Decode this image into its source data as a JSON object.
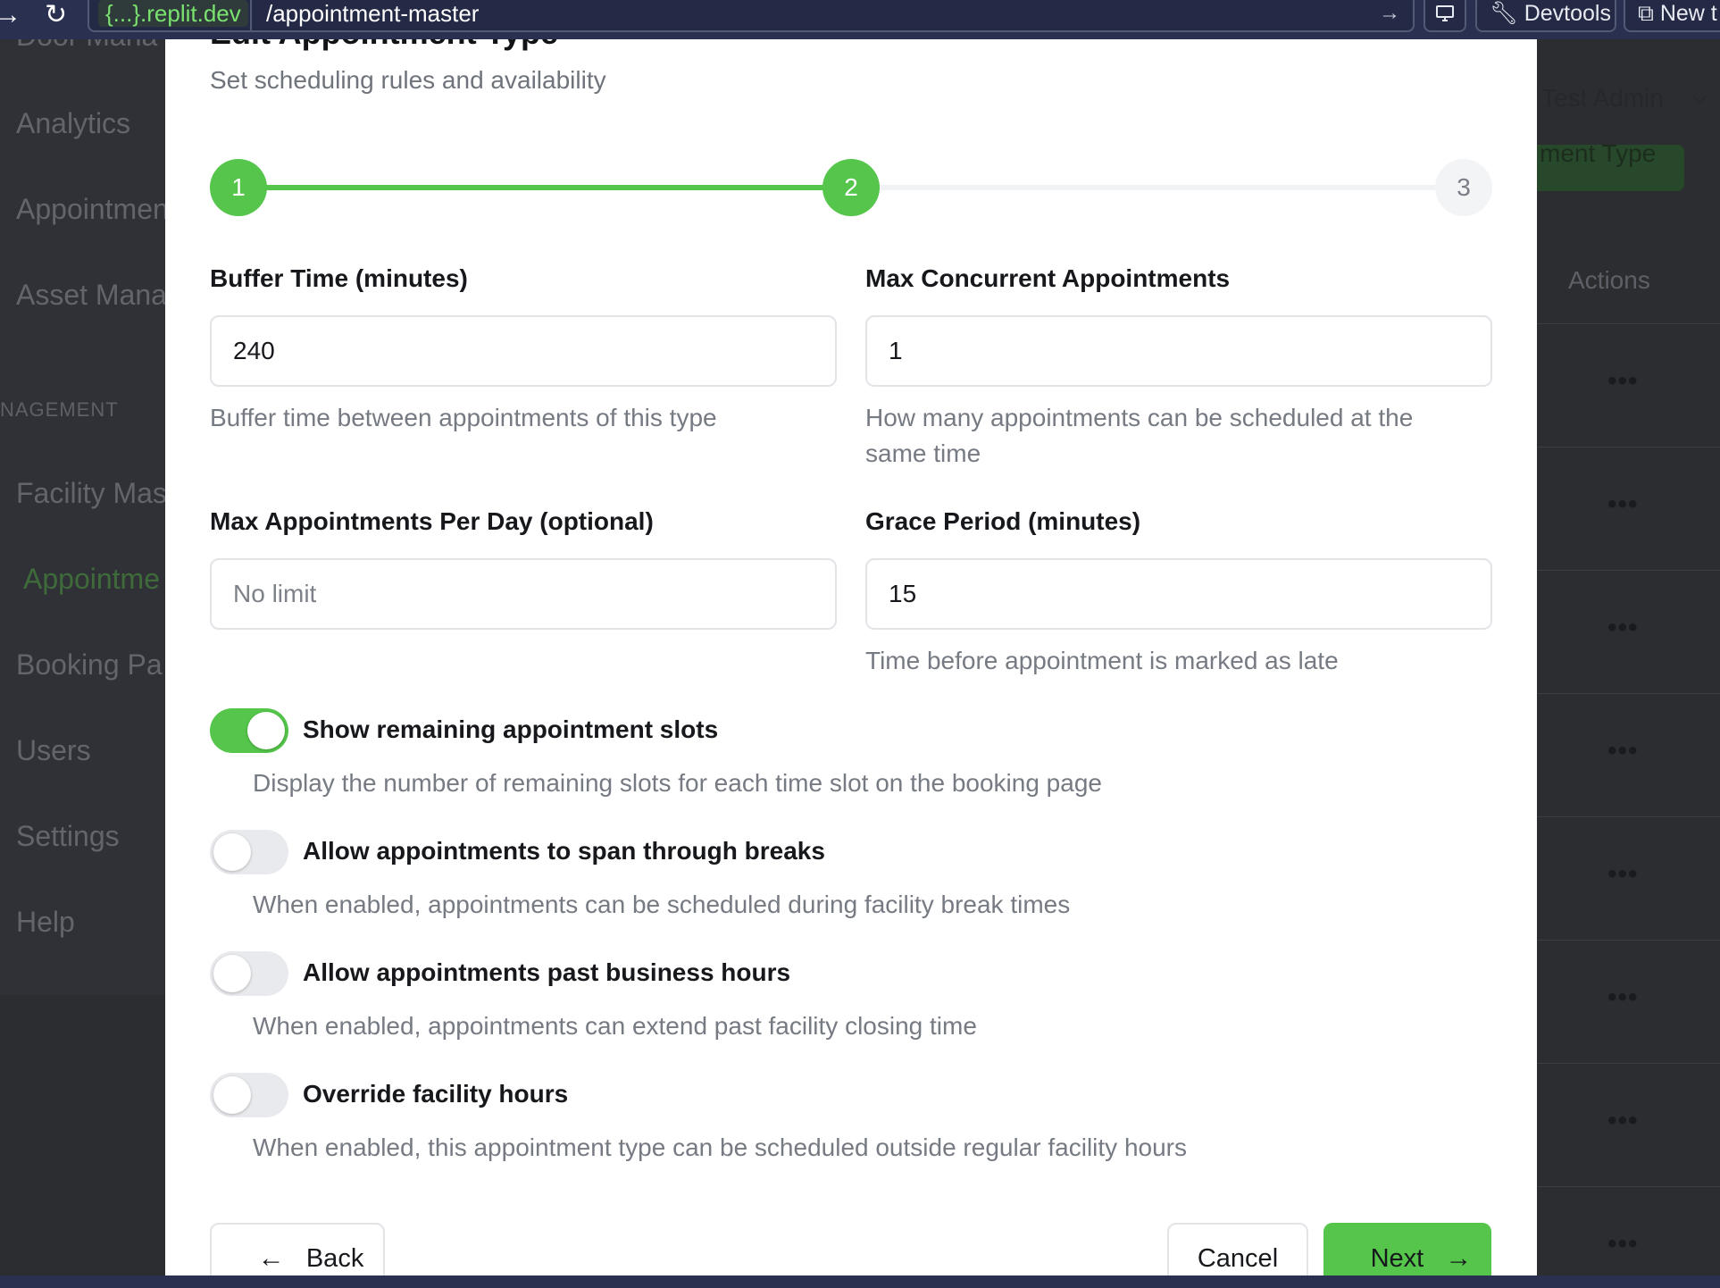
{
  "browser": {
    "domain": "{...}.replit.dev",
    "path": "/appointment-master",
    "devtools_label": "Devtools",
    "new_tab_label": "New t",
    "icons": [
      "forward-arrow-icon",
      "reload-icon",
      "go-arrow-icon",
      "monitor-icon",
      "wrench-icon",
      "external-link-icon"
    ]
  },
  "background": {
    "sidebar": {
      "items": [
        "Door Mana",
        "Analytics",
        "Appointmen",
        "Asset Mana",
        "Facility Mas",
        "Appointme",
        "Booking Pa",
        "Users",
        "Settings",
        "Help"
      ],
      "section_label": "NAGEMENT"
    },
    "header": {
      "user_name": "Test Admin",
      "create_button_label": "ment Type"
    },
    "table": {
      "actions_header": "Actions",
      "row_menu_glyph": "•••"
    }
  },
  "modal": {
    "title": "Edit Appointment Type",
    "subtitle": "Set scheduling rules and availability",
    "stepper": {
      "steps": [
        "1",
        "2",
        "3"
      ],
      "current_step": 2,
      "total_steps": 3
    },
    "fields": {
      "buffer_time": {
        "label": "Buffer Time (minutes)",
        "value": "240",
        "help": "Buffer time between appointments of this type"
      },
      "max_concurrent": {
        "label": "Max Concurrent Appointments",
        "value": "1",
        "help": "How many appointments can be scheduled at the same time"
      },
      "max_per_day": {
        "label": "Max Appointments Per Day (optional)",
        "value": "",
        "placeholder": "No limit"
      },
      "grace_period": {
        "label": "Grace Period (minutes)",
        "value": "15",
        "help": "Time before appointment is marked as late"
      }
    },
    "toggles": [
      {
        "label": "Show remaining appointment slots",
        "help": "Display the number of remaining slots for each time slot on the booking page",
        "on": true
      },
      {
        "label": "Allow appointments to span through breaks",
        "help": "When enabled, appointments can be scheduled during facility break times",
        "on": false
      },
      {
        "label": "Allow appointments past business hours",
        "help": "When enabled, appointments can extend past facility closing time",
        "on": false
      },
      {
        "label": "Override facility hours",
        "help": "When enabled, this appointment type can be scheduled outside regular facility hours",
        "on": false
      }
    ],
    "footer": {
      "back_label": "Back",
      "cancel_label": "Cancel",
      "next_label": "Next"
    }
  },
  "colors": {
    "accent_green": "#55c64b",
    "browser_bar": "#2a3150",
    "overlay": "#2b2d31"
  }
}
